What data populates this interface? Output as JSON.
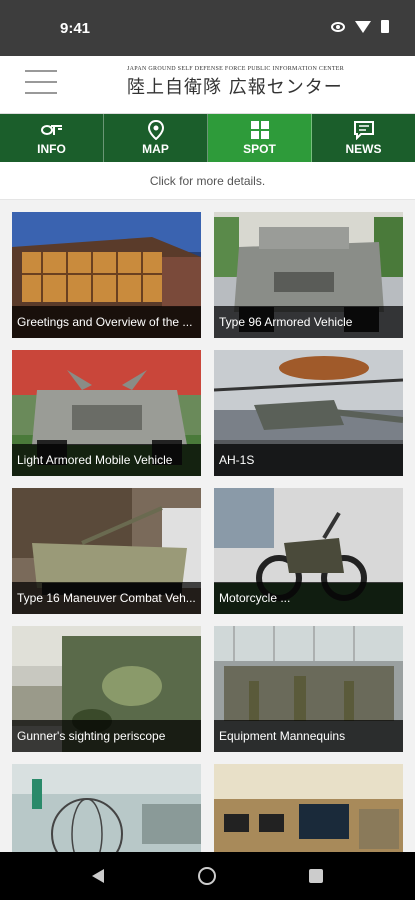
{
  "status": {
    "time": "9:41"
  },
  "header": {
    "logo_en": "JAPAN GROUND SELF DEFENSE FORCE  PUBLIC  INFORMATION CENTER",
    "logo_jp": "陸上自衛隊 広報センター"
  },
  "tabs": [
    {
      "label": "INFO",
      "icon": "info-logo-icon"
    },
    {
      "label": "MAP",
      "icon": "map-pin-icon"
    },
    {
      "label": "SPOT",
      "icon": "grid-icon"
    },
    {
      "label": "NEWS",
      "icon": "news-bubble-icon"
    }
  ],
  "active_tab": "SPOT",
  "hint": "Click for more details.",
  "spots": [
    {
      "caption": "Greetings and Overview of the ..."
    },
    {
      "caption": "Type 96 Armored Vehicle"
    },
    {
      "caption": "Light Armored Mobile Vehicle"
    },
    {
      "caption": "AH-1S"
    },
    {
      "caption": "Type 16 Maneuver Combat Veh..."
    },
    {
      "caption": "Motorcycle ..."
    },
    {
      "caption": "Gunner's sighting periscope"
    },
    {
      "caption": "Equipment Mannequins"
    },
    {
      "caption": ""
    },
    {
      "caption": ""
    }
  ],
  "colors": {
    "tab_bg": "#1b5e2b",
    "tab_active": "#2e9b3a"
  }
}
